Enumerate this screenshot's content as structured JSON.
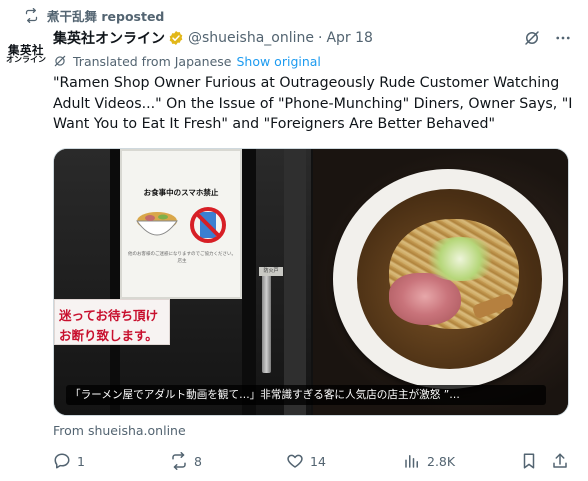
{
  "repost": {
    "text": "煮干乱舞 reposted",
    "icon": "repost-icon"
  },
  "author": {
    "avatar_line1": "集英社",
    "avatar_line2": "オンライン",
    "name": "集英社オンライン",
    "handle": "@shueisha_online",
    "separator": "·",
    "date": "Apr 18",
    "verified_color": "#e2b719"
  },
  "translation": {
    "label": "Translated from Japanese",
    "link": "Show original"
  },
  "tweet_text": "\"Ramen Shop Owner Furious at Outrageously Rude Customer Watching Adult Videos...\" On the Issue of \"Phone-Munching\" Diners, Owner Says, \"I Want You to Eat It Fresh\" and \"Foreigners Are Better Behaved\"",
  "media": {
    "sign_title": "お食事中のスマホ禁止",
    "sign_fine": "他のお客様のご迷惑になりますのでご協力ください。 店主",
    "door_tag": "防火戸",
    "red_sign_line1": "迷ってお待ち頂け",
    "red_sign_line2": "お断り致します。",
    "caption": "「ラーメン屋でアダルト動画を観て…」非常識すぎる客に人気店の店主が激怒 ”…"
  },
  "source": "From shueisha.online",
  "actions": {
    "reply": {
      "icon": "reply-icon",
      "count": "1"
    },
    "repost": {
      "icon": "repost-icon",
      "count": "8"
    },
    "like": {
      "icon": "heart-icon",
      "count": "14"
    },
    "views": {
      "icon": "views-icon",
      "count": "2.8K"
    },
    "bookmark": {
      "icon": "bookmark-icon"
    },
    "share": {
      "icon": "share-icon"
    }
  },
  "colors": {
    "text": "#0f1419",
    "secondary": "#536471",
    "link": "#1d9bf0"
  }
}
